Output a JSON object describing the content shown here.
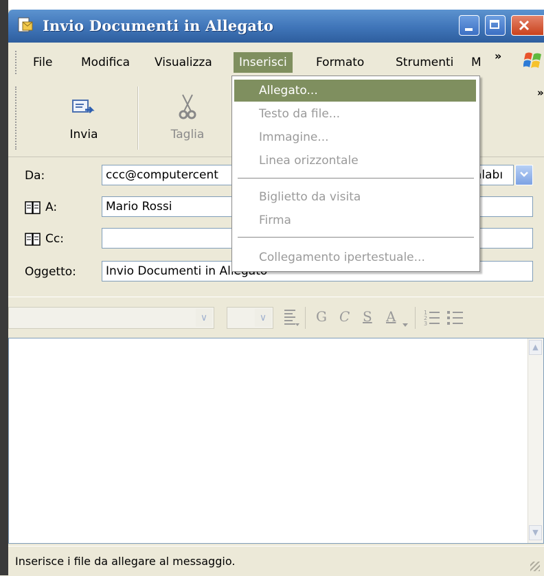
{
  "window": {
    "title": "Invio Documenti in Allegato",
    "controls": [
      "minimize-icon",
      "maximize-icon",
      "close-icon"
    ]
  },
  "menubar": {
    "items": [
      "File",
      "Modifica",
      "Visualizza",
      "Inserisci",
      "Formato",
      "Strumenti",
      "M"
    ],
    "overflow": "»",
    "active": "Inserisci"
  },
  "toolbar": {
    "send_label": "Invia",
    "cut_label": "Taglia",
    "overflow": "»"
  },
  "fields": {
    "from_label": "Da:",
    "from_value": "ccc@computercent",
    "from_suffix": "alabı",
    "to_label": "A:",
    "to_value": "Mario Rossi",
    "cc_label": "Cc:",
    "cc_value": "",
    "subject_label": "Oggetto:",
    "subject_value": "Invio Documenti in Allegato"
  },
  "format_toolbar": {
    "bold": "G",
    "italic": "C",
    "underline": "S",
    "font_color": "A"
  },
  "dropdown": {
    "items": [
      {
        "label": "Allegato...",
        "enabled": true,
        "highlighted": true
      },
      {
        "label": "Testo da file...",
        "enabled": false
      },
      {
        "label": "Immagine...",
        "enabled": false
      },
      {
        "label": "Linea orizzontale",
        "enabled": false
      },
      {
        "label": "Biglietto da visita",
        "enabled": false
      },
      {
        "label": "Firma",
        "enabled": false
      },
      {
        "label": "Collegamento ipertestuale...",
        "enabled": false
      }
    ]
  },
  "statusbar": {
    "text": "Inserisce i file da allegare al messaggio."
  },
  "colors": {
    "titlebar": "#3F74B8",
    "highlight": "#7F8F5F",
    "window_bg": "#ECE9D8"
  }
}
